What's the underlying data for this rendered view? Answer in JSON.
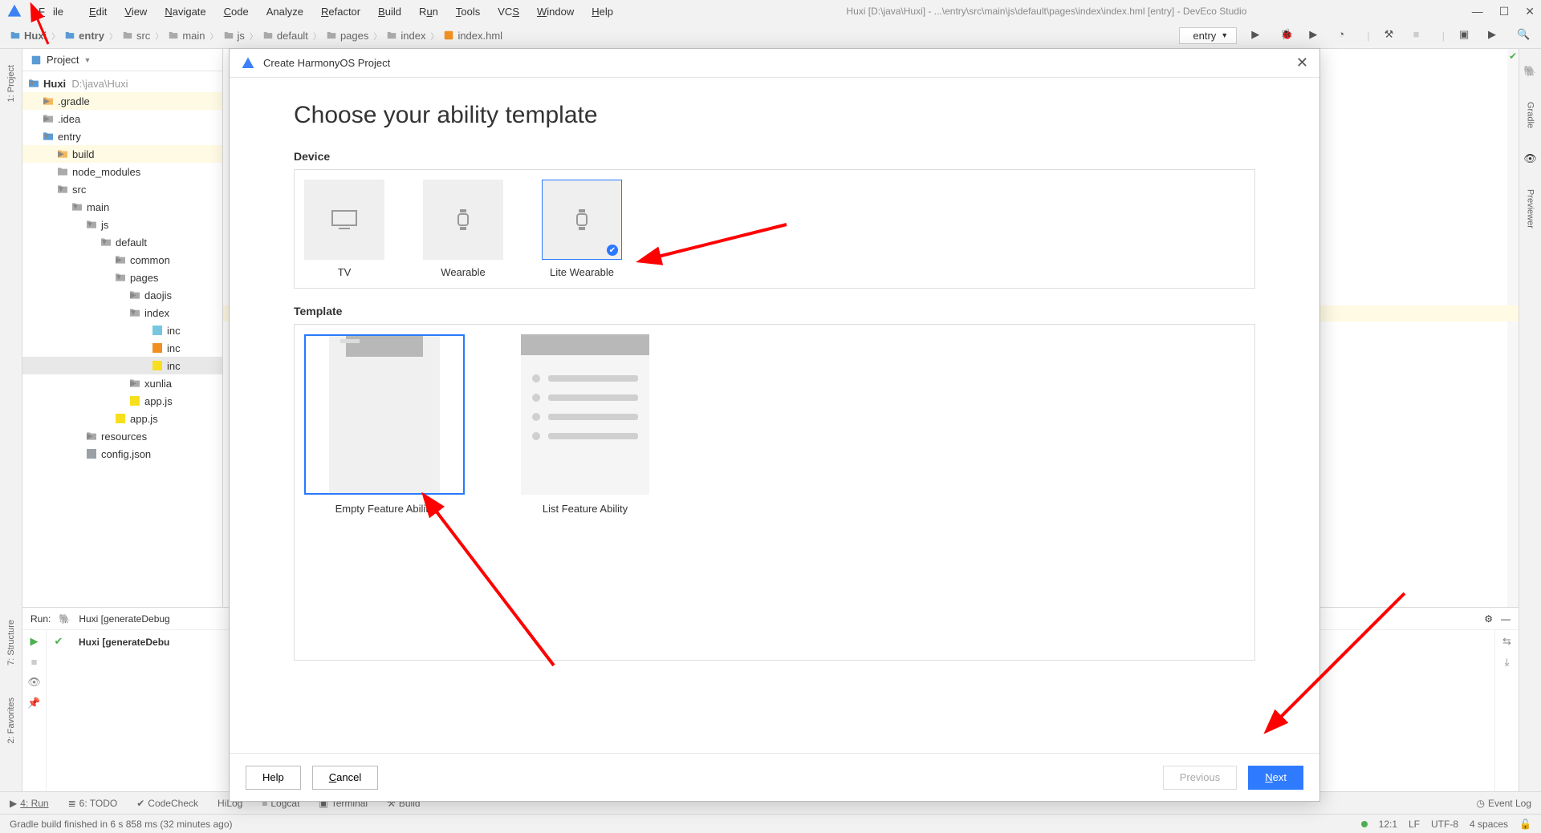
{
  "window": {
    "title": "Huxi [D:\\java\\Huxi] - ...\\entry\\src\\main\\js\\default\\pages\\index\\index.hml [entry] - DevEco Studio"
  },
  "menu": {
    "file": "File",
    "edit": "Edit",
    "view": "View",
    "navigate": "Navigate",
    "code": "Code",
    "analyze": "Analyze",
    "refactor": "Refactor",
    "build": "Build",
    "run": "Run",
    "tools": "Tools",
    "vcs": "VCS",
    "window": "Window",
    "help": "Help"
  },
  "breadcrumb": [
    "Huxi",
    "entry",
    "src",
    "main",
    "js",
    "default",
    "pages",
    "index",
    "index.hml"
  ],
  "nav": {
    "run_config": "entry"
  },
  "sidebar": {
    "header": "Project",
    "root": {
      "name": "Huxi",
      "path": "D:\\java\\Huxi"
    },
    "nodes": {
      "gradle": ".gradle",
      "idea": ".idea",
      "entry": "entry",
      "build": "build",
      "node_modules": "node_modules",
      "src": "src",
      "main": "main",
      "js": "js",
      "default": "default",
      "common": "common",
      "pages": "pages",
      "daojis": "daojis",
      "index": "index",
      "inc1": "inc",
      "inc2": "inc",
      "inc3": "inc",
      "xunlia": "xunlia",
      "appjs1": "app.js",
      "appjs2": "app.js",
      "resources": "resources",
      "configjson": "config.json"
    }
  },
  "gutter": {
    "left": {
      "project": "1: Project",
      "structure": "7: Structure",
      "favorites": "2: Favorites"
    },
    "right": {
      "gradle": "Gradle",
      "previewer": "Previewer"
    }
  },
  "run": {
    "title": "Run:",
    "config": "Huxi [generateDebug",
    "task": "Huxi [generateDebu"
  },
  "bottom": {
    "run": "4: Run",
    "todo": "6: TODO",
    "codecheck": "CodeCheck",
    "hilog": "HiLog",
    "logcat": "Logcat",
    "terminal": "Terminal",
    "buildtool": "Build",
    "eventlog": "Event Log"
  },
  "status": {
    "msg": "Gradle build finished in 6 s 858 ms (32 minutes ago)",
    "pos": "12:1",
    "lineend": "LF",
    "enc": "UTF-8",
    "indent": "4 spaces"
  },
  "modal": {
    "title": "Create HarmonyOS Project",
    "heading": "Choose your ability template",
    "device_label": "Device",
    "devices": {
      "tv": "TV",
      "wearable": "Wearable",
      "lite": "Lite Wearable"
    },
    "template_label": "Template",
    "templates": {
      "empty": "Empty Feature Ability",
      "list": "List Feature Ability"
    },
    "buttons": {
      "help": "Help",
      "cancel": "Cancel",
      "previous": "Previous",
      "next": "Next"
    }
  }
}
